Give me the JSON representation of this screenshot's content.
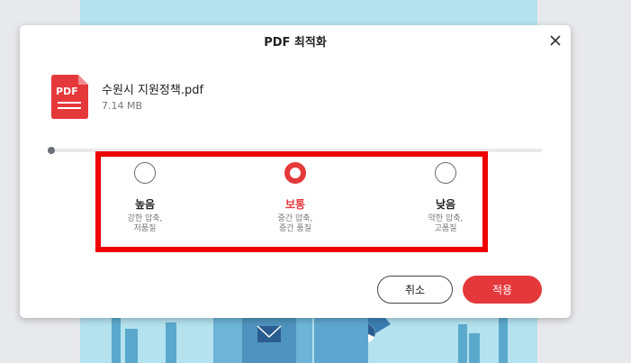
{
  "dialog": {
    "title": "PDF 최적화",
    "close_icon": "close-icon"
  },
  "file": {
    "icon_label": "PDF",
    "name": "수원시 지원정책.pdf",
    "size": "7.14 MB"
  },
  "options": [
    {
      "label": "높음",
      "desc": "강한 압축,\n저품질",
      "selected": false
    },
    {
      "label": "보통",
      "desc": "중간 압축,\n중간 품질",
      "selected": true
    },
    {
      "label": "낮음",
      "desc": "약한 압축,\n고품질",
      "selected": false
    }
  ],
  "buttons": {
    "cancel": "취소",
    "apply": "적용"
  },
  "colors": {
    "accent": "#e5383b",
    "highlight": "#ee0000",
    "background_page": "#b4e2ef"
  }
}
